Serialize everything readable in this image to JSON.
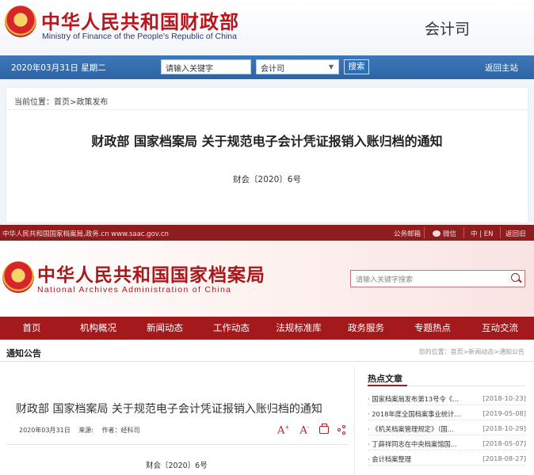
{
  "mof": {
    "title": "中华人民共和国财政部",
    "subtitle": "Ministry of Finance of the People's Republic of China",
    "department": "会计司",
    "date": "2020年03月31日  星期二",
    "search_placeholder": "请输入关键字",
    "select_value": "会计司",
    "search_button": "搜索",
    "home_link": "返回主站",
    "breadcrumb": "当前位置：首页>政策发布",
    "article_title": "财政部 国家档案局 关于规范电子会计凭证报销入账归档的通知",
    "doc_number": "财会〔2020〕6号"
  },
  "saac": {
    "topbar": {
      "site_url": "中华人民共和国国家档案局,政务.cn www.saac.gov.cn",
      "mail": "公务邮箱",
      "wechat": "微信",
      "lang": "中 | EN",
      "back_home": "返回旧"
    },
    "title": "中华人民共和国国家档案局",
    "subtitle": "National Archives Administration of China",
    "search_placeholder": "请输入关键字搜索",
    "nav": [
      "首页",
      "机构概况",
      "新闻动态",
      "工作动态",
      "法规标准库",
      "政务服务",
      "专题热点",
      "互动交流"
    ],
    "notice_label": "通知公告",
    "breadcrumb": "您的位置：首页>新闻动态>通知公告",
    "article_title": "财政部 国家档案局 关于规范电子会计凭证报销入账归档的通知",
    "meta": {
      "date": "2020年03月31日",
      "source": "来源:",
      "author": "作者：经科司"
    },
    "tools": {
      "font_up": "A",
      "font_down": "A",
      "font_up_sup": "+",
      "font_down_sup": "-"
    },
    "doc_number": "财会〔2020〕6号",
    "hot": {
      "title": "热点文章",
      "items": [
        {
          "text": "· 国家档案局发布第13号令《...",
          "date": "[2018-10-23]"
        },
        {
          "text": "· 2018年度全国档案事业统计...",
          "date": "[2019-05-08]"
        },
        {
          "text": "· 《机关档案管理规定》（国...",
          "date": "[2018-10-29]"
        },
        {
          "text": "· 丁薛祥同志在中央档案馆国...",
          "date": "[2018-05-07]"
        },
        {
          "text": "· 会计档案整理",
          "date": "[2018-08-27]"
        }
      ]
    }
  },
  "colors": {
    "mof_brand_red": "#b8161c",
    "mof_bar_blue": "#2c63a6",
    "saac_brand_red": "#a3191c",
    "saac_topbar": "#8f1d1f"
  }
}
